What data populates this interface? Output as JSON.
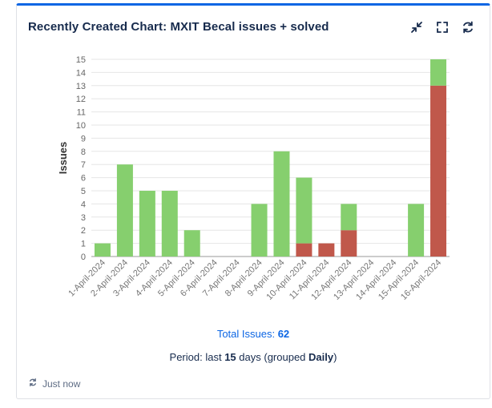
{
  "card": {
    "title": "Recently Created Chart: MXIT Becal issues + solved"
  },
  "header_icons": [
    "collapse-icon",
    "fullscreen-icon",
    "refresh-icon"
  ],
  "summary": {
    "total_label": "Total Issues:",
    "total_value": "62",
    "period_prefix": "Period: last",
    "period_days": "15",
    "period_mid": "days (grouped",
    "period_group": "Daily",
    "period_suffix": ")"
  },
  "footer": {
    "updated": "Just now"
  },
  "colors": {
    "created": "#86cf6e",
    "resolved": "#c0584b",
    "accent": "#0c66e4"
  },
  "chart_data": {
    "type": "bar",
    "stacked": true,
    "ylabel": "Issues",
    "xlabel": "",
    "ylim": [
      0,
      15
    ],
    "grid": true,
    "categories": [
      "1-April-2024",
      "2-April-2024",
      "3-April-2024",
      "4-April-2024",
      "5-April-2024",
      "6-April-2024",
      "7-April-2024",
      "8-April-2024",
      "9-April-2024",
      "10-April-2024",
      "11-April-2024",
      "12-April-2024",
      "13-April-2024",
      "14-April-2024",
      "15-April-2024",
      "16-April-2024"
    ],
    "series": [
      {
        "values": [
          0,
          0,
          0,
          0,
          0,
          0,
          0,
          0,
          0,
          1,
          1,
          2,
          0,
          0,
          0,
          13
        ]
      },
      {
        "values": [
          1,
          7,
          5,
          5,
          2,
          0,
          0,
          4,
          8,
          5,
          0,
          2,
          0,
          0,
          4,
          2
        ]
      }
    ]
  }
}
